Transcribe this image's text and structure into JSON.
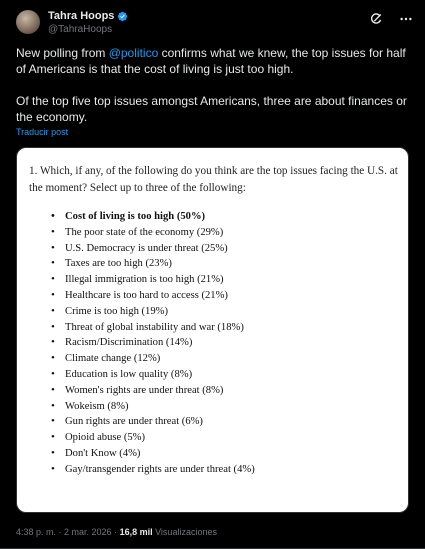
{
  "author": {
    "display_name": "Tahra Hoops",
    "handle": "@TahraHoops"
  },
  "tweet": {
    "paragraph1_before": "New polling from ",
    "mention": "@politico",
    "paragraph1_after": " confirms what we knew, the top issues for half of Americans is that the cost of living is just too high.",
    "paragraph2": "Of the top five top issues amongst Americans, three are about finances or the economy.",
    "translate_label": "Traducir post"
  },
  "image": {
    "question": "1. Which, if any, of the following do you think are the top issues facing the U.S. at the moment? Select up to three of the following:",
    "issues": [
      "Cost of living is too high (50%)",
      "The poor state of the economy (29%)",
      "U.S. Democracy is under threat (25%)",
      "Taxes are too high (23%)",
      "Illegal immigration is too high (21%)",
      "Healthcare is too hard to access (21%)",
      "Crime is too high (19%)",
      "Threat of global instability and war (18%)",
      "Racism/Discrimination (14%)",
      "Climate change (12%)",
      "Education is low quality (8%)",
      "Women's rights are under threat (8%)",
      "Wokeism (8%)",
      "Gun rights are under threat (6%)",
      "Opioid abuse (5%)",
      "Don't Know (4%)",
      "Gay/transgender rights are under threat (4%)"
    ]
  },
  "meta": {
    "time": "4:38 p. m.",
    "separator": " · ",
    "date": "2 mar. 2026",
    "views_count": "16,8 mil",
    "views_label": " Visualizaciones"
  },
  "icons": {
    "verified": "verified-badge-icon",
    "grok": "grok-icon",
    "more": "more-icon"
  },
  "colors": {
    "background": "#000000",
    "text": "#e7e9ea",
    "secondary": "#71767b",
    "accent": "#1d9bf0"
  }
}
